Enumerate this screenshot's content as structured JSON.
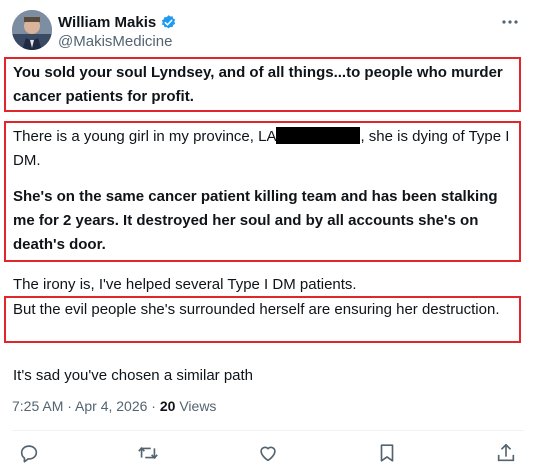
{
  "author": {
    "name": "William Makis",
    "handle": "@MakisMedicine",
    "verified": true
  },
  "post": {
    "para1": "You sold your soul Lyndsey, and of all things...to people who murder cancer patients for profit.",
    "para2_before": "There is a young girl in my province, LA",
    "para2_after": ", she is dying of Type I DM.",
    "para3": "She's on the same cancer patient killing team and has been stalking me for 2 years. It destroyed her soul and by all accounts she's on death's door.",
    "para4": "The irony is, I've helped several Type I DM patients.",
    "para5": "But the evil people she's surrounded herself are ensuring her destruction.",
    "para6": "It's sad you've chosen a similar path"
  },
  "meta": {
    "timestamp": "7:25 AM · Apr 4, 2026 · ",
    "views_count": "20",
    "views_label": " Views"
  },
  "colors": {
    "highlight_border": "#e0252b",
    "verified_badge": "#1d9bf0",
    "secondary_text": "#536471"
  },
  "icons": [
    "more-icon",
    "reply-icon",
    "repost-icon",
    "like-icon",
    "bookmark-icon",
    "share-icon",
    "verified-badge-icon"
  ]
}
